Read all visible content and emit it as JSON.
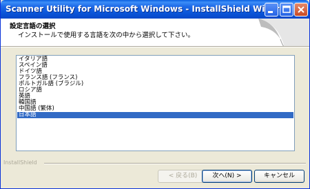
{
  "window": {
    "title": "Scanner Utility for Microsoft Windows - InstallShield Wizard"
  },
  "header": {
    "title": "設定言語の選択",
    "subtitle": "インストールで使用する言語を次の中から選択して下さい。"
  },
  "languages": {
    "items": [
      "イタリア語",
      "スペイン語",
      "ドイツ語",
      "フランス語 (フランス)",
      "ポルトガル語 (ブラジル)",
      "ロシア語",
      "英語",
      "韓国語",
      "中国語 (繁体)",
      "日本語"
    ],
    "selected_index": 9
  },
  "footer": {
    "brand": "InstallShield"
  },
  "buttons": {
    "back": "< 戻る(B)",
    "next": "次へ(N) >",
    "cancel": "キャンセル"
  },
  "colors": {
    "selection": "#316AC5",
    "titlebar": "#0A55D8"
  }
}
